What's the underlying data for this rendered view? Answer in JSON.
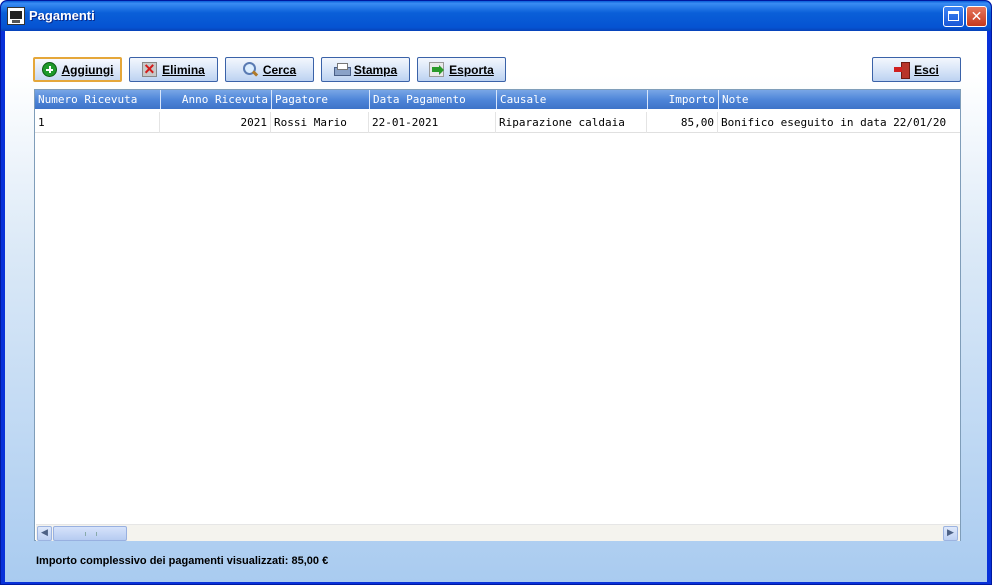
{
  "window": {
    "title": "Pagamenti"
  },
  "toolbar": {
    "add_label": "Aggiungi",
    "delete_label": "Elimina",
    "search_label": "Cerca",
    "print_label": "Stampa",
    "export_label": "Esporta",
    "exit_label": "Esci"
  },
  "table": {
    "columns": [
      "Numero Ricevuta",
      "Anno Ricevuta",
      "Pagatore",
      "Data Pagamento",
      "Causale",
      "Importo",
      "Note"
    ],
    "rows": [
      [
        "1",
        "2021",
        "Rossi Mario",
        "22-01-2021",
        "Riparazione caldaia",
        "85,00",
        "Bonifico eseguito in data 22/01/20"
      ]
    ]
  },
  "footer": {
    "total_text": "Importo complessivo dei pagamenti visualizzati: 85,00 €"
  },
  "colors": {
    "header_bg": "#4f86d9",
    "titlebar": "#0553d2"
  }
}
